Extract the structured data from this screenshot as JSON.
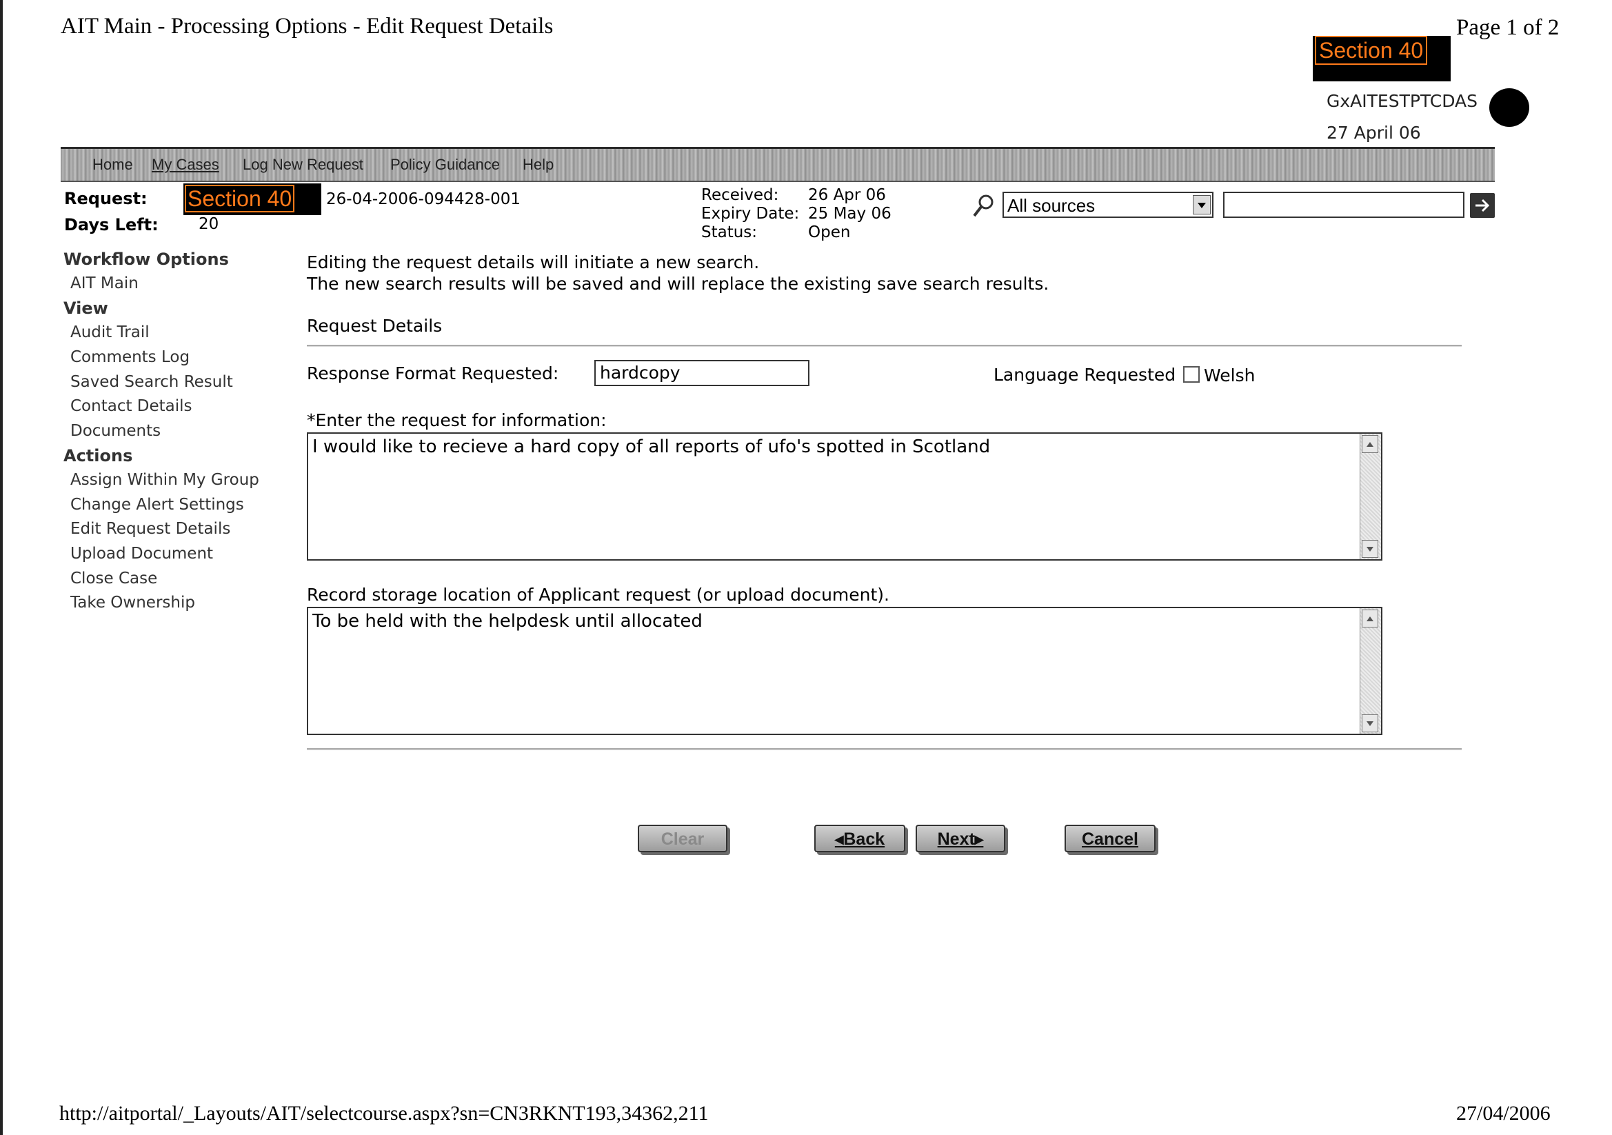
{
  "print_header": {
    "title": "AIT Main - Processing Options - Edit Request Details",
    "page": "Page 1 of 2",
    "redaction_label": "Section 40",
    "user": "GxAITESTPTCDAS",
    "date": "27 April 06"
  },
  "nav": {
    "items": [
      {
        "label": "Home"
      },
      {
        "label": "My Cases"
      },
      {
        "label": "Log New Request"
      },
      {
        "label": "Policy Guidance"
      },
      {
        "label": "Help"
      }
    ]
  },
  "request": {
    "request_label": "Request:",
    "redaction_label": "Section 40",
    "request_id": "26-04-2006-094428-001",
    "days_left_label": "Days Left:",
    "days_left": "20",
    "received_label": "Received:",
    "received": "26 Apr 06",
    "expiry_label": "Expiry Date:",
    "expiry": "25 May 06",
    "status_label": "Status:",
    "status": "Open"
  },
  "search": {
    "source_value": "All sources",
    "query": "",
    "icons": {
      "search": "magnifier-icon",
      "go": "arrow-right-icon"
    }
  },
  "sidebar": {
    "workflow_heading": "Workflow Options",
    "workflow_items": [
      "AIT Main"
    ],
    "view_heading": "View",
    "view_items": [
      "Audit Trail",
      "Comments Log",
      "Saved Search Result",
      "Contact Details",
      "Documents"
    ],
    "actions_heading": "Actions",
    "actions_items": [
      "Assign Within My Group",
      "Change Alert Settings",
      "Edit Request Details",
      "Upload Document",
      "Close Case",
      "Take Ownership"
    ]
  },
  "main": {
    "notice_line1": "Editing the request details will initiate a new search.",
    "notice_line2": "The new search results will be saved and will replace the existing save search results.",
    "section_title": "Request Details",
    "format_label": "Response Format Requested:",
    "format_value": "hardcopy",
    "language_label": "Language Requested",
    "welsh_label": "Welsh",
    "request_label": "*Enter the request for information:",
    "request_text": "I would like to recieve a hard copy of all reports of ufo's spotted in Scotland",
    "storage_label": "Record storage location of Applicant request (or upload document).",
    "storage_text": "To be held with the helpdesk until allocated"
  },
  "buttons": {
    "clear": "Clear",
    "back": "◂Back",
    "next": "Next▸",
    "cancel": "Cancel"
  },
  "footer": {
    "url": "http://aitportal/_Layouts/AIT/selectcourse.aspx?sn=CN3RKNT193,34362,211",
    "date": "27/04/2006"
  }
}
